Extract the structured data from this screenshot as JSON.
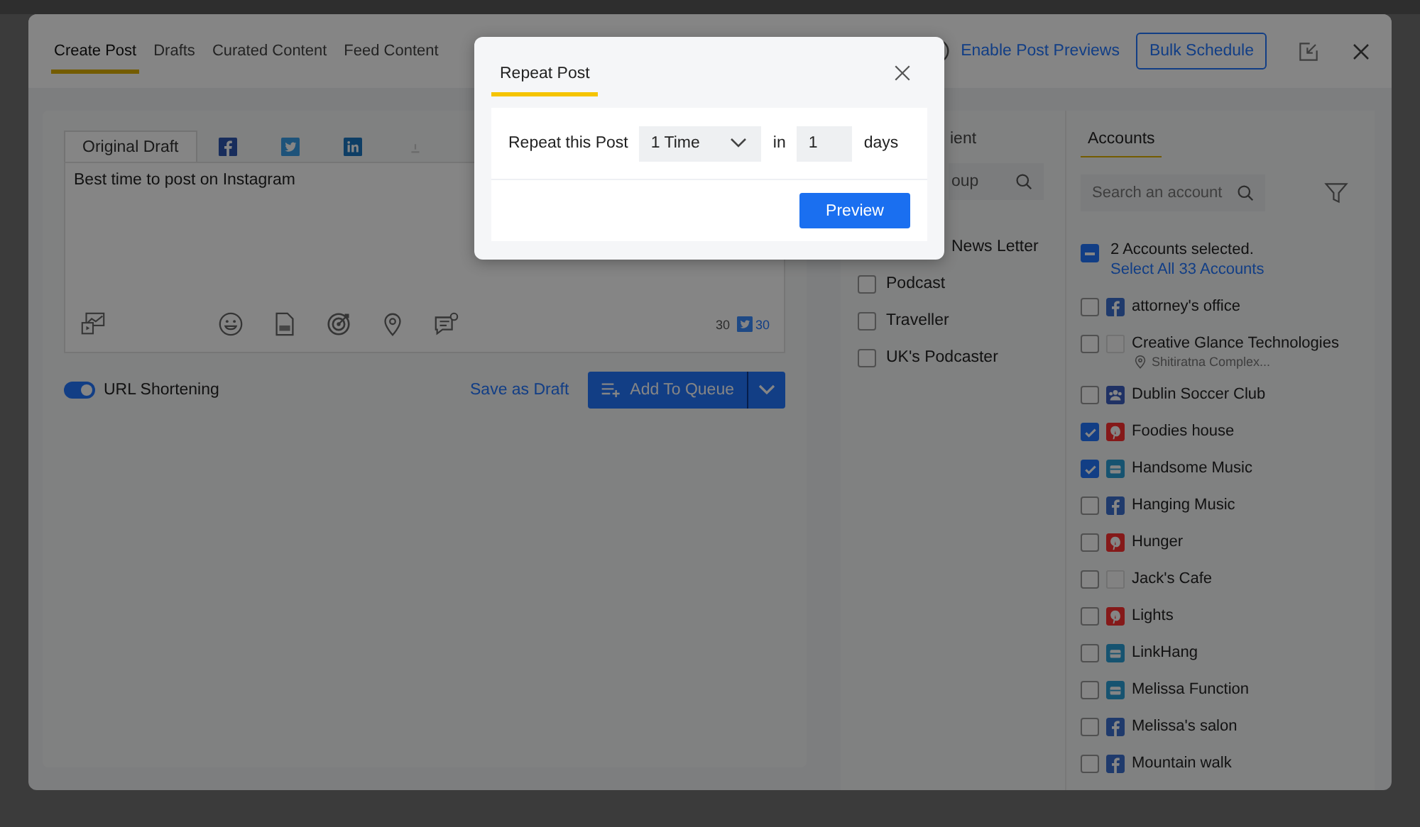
{
  "header": {
    "tabs": [
      {
        "label": "Create Post",
        "selected": true
      },
      {
        "label": "Drafts",
        "selected": false
      },
      {
        "label": "Curated Content",
        "selected": false
      },
      {
        "label": "Feed Content",
        "selected": false
      }
    ],
    "preview_link": "Enable Post Previews",
    "bulk_button": "Bulk Schedule"
  },
  "composer": {
    "tabs": [
      {
        "kind": "text",
        "label": "Original Draft",
        "selected": true
      },
      {
        "kind": "facebook",
        "selected": false
      },
      {
        "kind": "twitter",
        "selected": false
      },
      {
        "kind": "linkedin",
        "selected": false
      },
      {
        "kind": "muted",
        "selected": false
      }
    ],
    "text": "Best time to post on Instagram",
    "counters": [
      {
        "kind": "plain",
        "text": "30"
      },
      {
        "kind": "twitter",
        "text": "30"
      }
    ],
    "url_shortening": {
      "label": "URL Shortening",
      "on": true
    },
    "save_draft": "Save as Draft",
    "queue_button": "Add To Queue"
  },
  "groups": {
    "tab": "ient",
    "search_placeholder": "oup",
    "partial_item": "News Letter",
    "items": [
      {
        "name": "Podcast",
        "checked": false
      },
      {
        "name": "Traveller",
        "checked": false
      },
      {
        "name": "UK's Podcaster",
        "checked": false
      }
    ]
  },
  "accounts": {
    "tab": "Accounts",
    "search_placeholder": "Search an account",
    "indeterminate": true,
    "selection_text": "2 Accounts selected.",
    "select_all_link": "Select All 33 Accounts",
    "items": [
      {
        "name": "attorney's office",
        "kind": "facebook",
        "checked": false
      },
      {
        "name": "Creative Glance Technologies",
        "kind": "none",
        "checked": false,
        "location": "Shitiratna Complex..."
      },
      {
        "name": "Dublin Soccer Club",
        "kind": "group",
        "checked": false
      },
      {
        "name": "Foodies house",
        "kind": "pinterest",
        "checked": true
      },
      {
        "name": "Handsome Music",
        "kind": "business",
        "checked": true
      },
      {
        "name": "Hanging Music",
        "kind": "facebook",
        "checked": false
      },
      {
        "name": "Hunger",
        "kind": "pinterest",
        "checked": false
      },
      {
        "name": "Jack's Cafe",
        "kind": "none",
        "checked": false
      },
      {
        "name": "Lights",
        "kind": "pinterest",
        "checked": false
      },
      {
        "name": "LinkHang",
        "kind": "business",
        "checked": false
      },
      {
        "name": "Melissa Function",
        "kind": "business",
        "checked": false
      },
      {
        "name": "Melissa's salon",
        "kind": "facebook",
        "checked": false
      },
      {
        "name": "Mountain walk",
        "kind": "facebook",
        "checked": false
      }
    ]
  },
  "repeat_dialog": {
    "title": "Repeat Post",
    "label": "Repeat this Post",
    "times": "1 Time",
    "in_label": "in",
    "days_value": "1",
    "days_label": "days",
    "preview_button": "Preview"
  }
}
